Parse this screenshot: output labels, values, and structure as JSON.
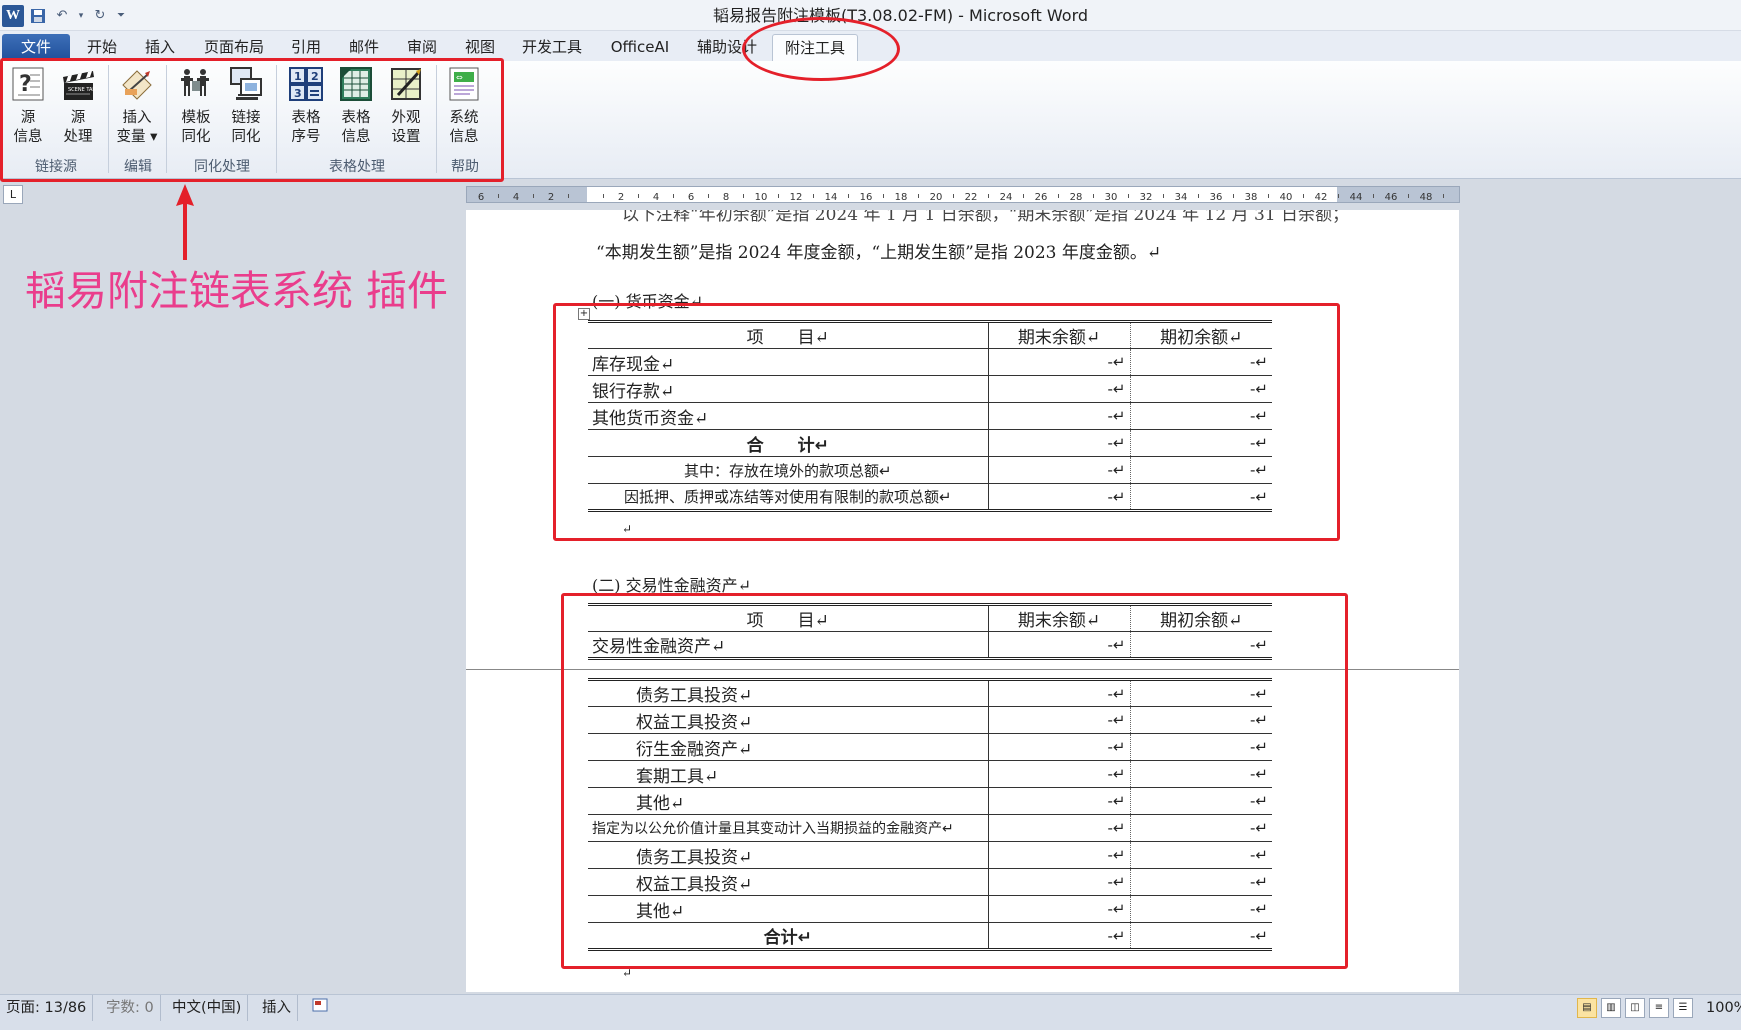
{
  "titlebar": {
    "title": "韬易报告附注模板(T3.08.02-FM) - Microsoft Word",
    "app_logo": "W"
  },
  "tabs": [
    "文件",
    "开始",
    "插入",
    "页面布局",
    "引用",
    "邮件",
    "审阅",
    "视图",
    "开发工具",
    "OfficeAI",
    "辅助设计",
    "附注工具"
  ],
  "ribbon": {
    "buttons": [
      {
        "label1": "源",
        "label2": "信息",
        "icon": "source-info-icon"
      },
      {
        "label1": "源",
        "label2": "处理",
        "icon": "clapperboard-icon"
      },
      {
        "label1": "插入",
        "label2": "变量 ▾",
        "icon": "insert-variable-icon"
      },
      {
        "label1": "模板",
        "label2": "同化",
        "icon": "template-sync-icon"
      },
      {
        "label1": "链接",
        "label2": "同化",
        "icon": "link-sync-icon"
      },
      {
        "label1": "表格",
        "label2": "序号",
        "icon": "table-number-icon"
      },
      {
        "label1": "表格",
        "label2": "信息",
        "icon": "table-info-icon"
      },
      {
        "label1": "外观",
        "label2": "设置",
        "icon": "appearance-icon"
      },
      {
        "label1": "系统",
        "label2": "信息",
        "icon": "system-info-icon"
      }
    ],
    "groups": [
      "链接源",
      "编辑",
      "同化处理",
      "表格处理",
      "帮助"
    ]
  },
  "annotation": {
    "text": "韬易附注链表系统 插件",
    "color": "#ea3d8c",
    "box_color": "#e4202a"
  },
  "ruler": {
    "ticks": [
      "6",
      "4",
      "2",
      "",
      "2",
      "4",
      "6",
      "8",
      "10",
      "12",
      "14",
      "16",
      "18",
      "20",
      "22",
      "24",
      "26",
      "28",
      "30",
      "32",
      "34",
      "36",
      "38",
      "40",
      "42",
      "44",
      "46",
      "48"
    ]
  },
  "document": {
    "cut_line": "以下注释“年初余额”是指 2024 年 1 月 1 日余额，“期末余额”是指 2024 年 12 月 31 日余额；",
    "intro": "“本期发生额”是指 2024 年度金额，“上期发生额”是指 2023 年度金额。↵",
    "section1_title": "(一)  货币资金↵",
    "section2_title": "(二)  交易性金融资产↵",
    "table_header": [
      "项　　目↵",
      "期末余额↵",
      "期初余额↵"
    ],
    "cell_dash": "-↵",
    "table1_rows": [
      "库存现金↵",
      "银行存款↵",
      "其他货币资金↵",
      "合　　计↵",
      "其中：存放在境外的款项总额↵",
      "因抵押、质押或冻结等对使用有限制的款项总额↵"
    ],
    "table2_first_row": "交易性金融资产↵",
    "table2_rows": [
      "债务工具投资↵",
      "权益工具投资↵",
      "衍生金融资产↵",
      "套期工具↵",
      "其他↵",
      "指定为以公允价值计量且其变动计入当期损益的金融资产↵",
      "债务工具投资↵",
      "权益工具投资↵",
      "其他↵",
      "合计↵"
    ],
    "para_mark": "↵"
  },
  "statusbar": {
    "page": "页面: 13/86",
    "words": "字数: 0",
    "language": "中文(中国)",
    "mode": "插入",
    "zoom": "100%"
  }
}
